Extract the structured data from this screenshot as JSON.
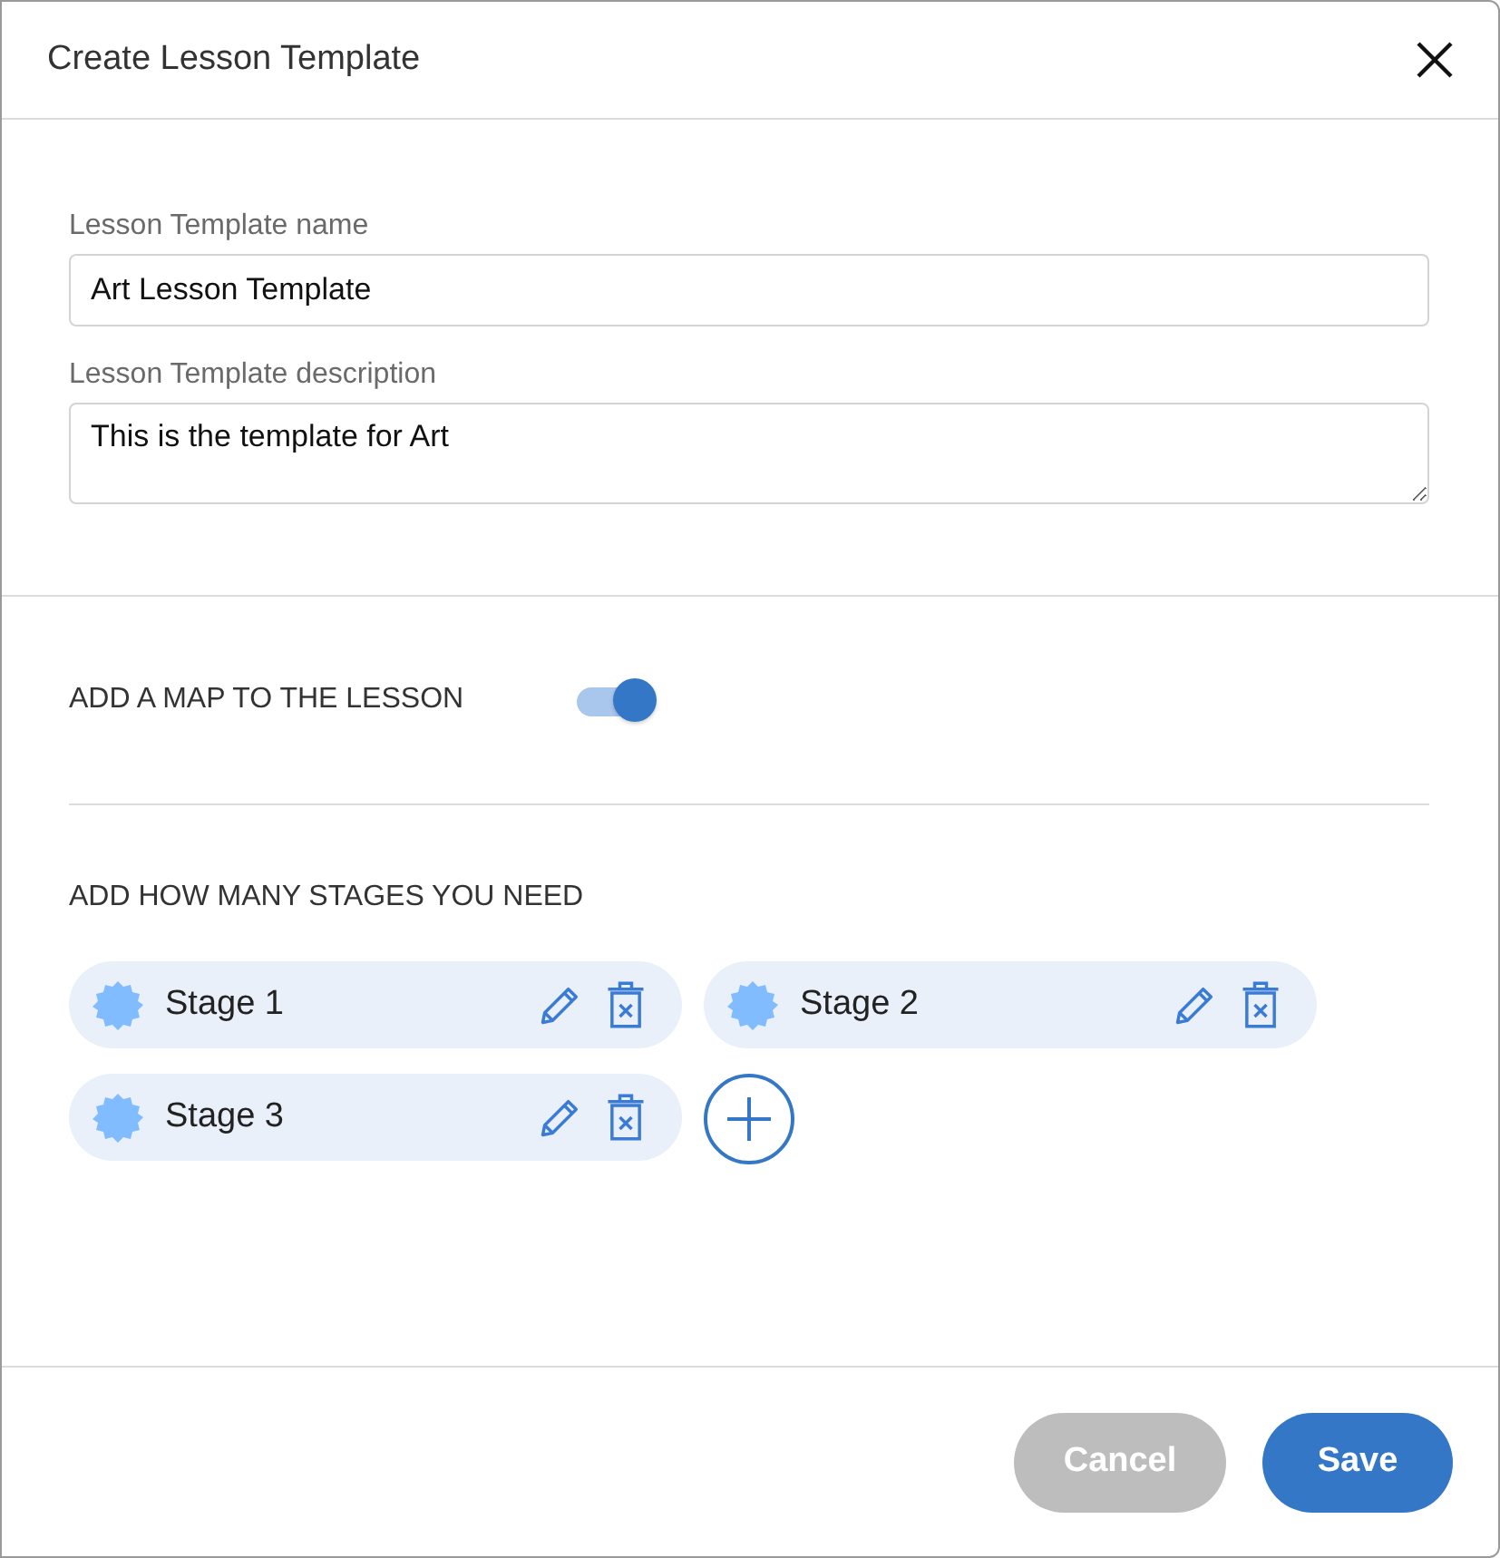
{
  "dialog": {
    "title": "Create Lesson Template"
  },
  "fields": [
    {
      "label": "Lesson Template name",
      "value": "Art Lesson Template",
      "kind": "input"
    },
    {
      "label": "Lesson Template description",
      "value": "This is the template for Art",
      "kind": "textarea"
    }
  ],
  "map_toggle": {
    "label": "ADD A MAP TO THE LESSON",
    "on": true
  },
  "stages": {
    "heading": "ADD HOW MANY STAGES YOU NEED",
    "items": [
      {
        "label": "Stage 1"
      },
      {
        "label": "Stage 2"
      },
      {
        "label": "Stage 3"
      }
    ]
  },
  "buttons": [
    {
      "label": "Cancel",
      "kind": "secondary"
    },
    {
      "label": "Save",
      "kind": "primary"
    }
  ]
}
